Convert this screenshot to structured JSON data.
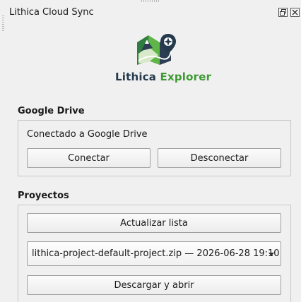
{
  "window": {
    "title": "Lithica Cloud Sync"
  },
  "logo": {
    "name_part1": "Lithica",
    "name_part2": "Explorer",
    "colors": {
      "dark": "#263a4e",
      "green": "#3f9a34"
    }
  },
  "google_drive": {
    "title": "Google Drive",
    "status": "Conectado a Google Drive",
    "connect_label": "Conectar",
    "disconnect_label": "Desconectar"
  },
  "projects": {
    "title": "Proyectos",
    "refresh_label": "Actualizar lista",
    "selected_project": "lithica-project-default-project.zip — 2026-06-28 19:10",
    "download_label": "Descargar y abrir"
  }
}
